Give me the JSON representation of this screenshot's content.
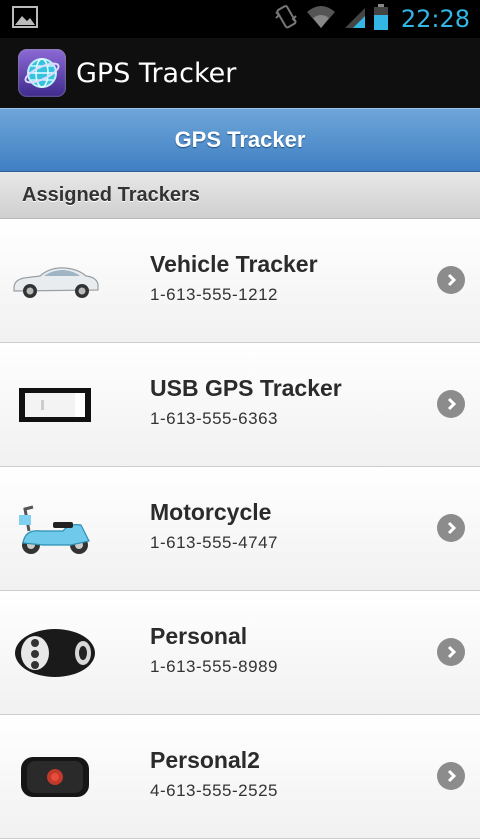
{
  "status_bar": {
    "time": "22:28"
  },
  "app_bar": {
    "title": "GPS Tracker",
    "icon": "globe-icon"
  },
  "header": {
    "title": "GPS Tracker"
  },
  "section": {
    "title": "Assigned Trackers"
  },
  "trackers": [
    {
      "name": "Vehicle Tracker",
      "phone": "1-613-555-1212",
      "icon": "car-icon"
    },
    {
      "name": "USB GPS Tracker",
      "phone": "1-613-555-6363",
      "icon": "usb-tracker-icon"
    },
    {
      "name": "Motorcycle",
      "phone": "1-613-555-4747",
      "icon": "scooter-icon"
    },
    {
      "name": "Personal",
      "phone": "1-613-555-8989",
      "icon": "personal-tracker-icon"
    },
    {
      "name": "Personal2",
      "phone": "4-613-555-2525",
      "icon": "personal-tracker-2-icon"
    }
  ]
}
